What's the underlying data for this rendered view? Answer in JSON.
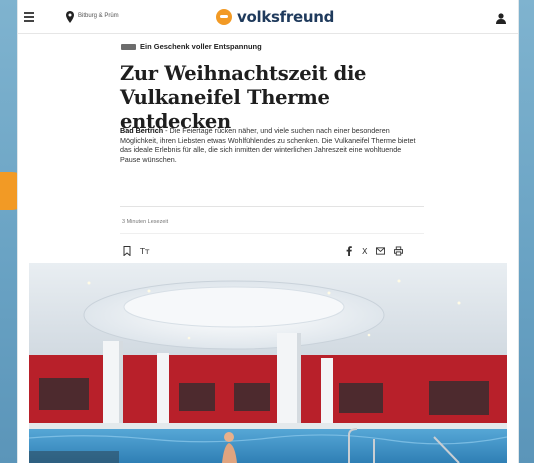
{
  "topbar": {
    "menu_label": "Ξ≡",
    "region_label": "Bitburg & Prüm",
    "logo_text": "volksfreund"
  },
  "article": {
    "kicker": "Ein Geschenk voller Entspannung",
    "headline": "Zur Weihnachtszeit die Vulkaneifel Therme entdecken",
    "teaser_location": "Bad Bertrich",
    "teaser_body": " - Die Feiertage rücken näher, und viele suchen nach einer besonderen Möglichkeit, ihren Liebsten etwas Wohlfühlendes zu schenken. Die Vulkaneifel Therme bietet das ideale Erlebnis für alle, die sich inmitten der winterlichen Jahreszeit eine wohltuende Pause wünschen.",
    "read_time": "3 Minuten Lesezeit"
  },
  "toolbar": {
    "text_size_label": "Tт",
    "share_x_label": "X"
  },
  "colors": {
    "accent_orange": "#f29a25",
    "logo_blue": "#1f3a5c",
    "photo_wall_red": "#b8202a",
    "photo_water": "#3f93c8"
  },
  "icons": [
    "menu-icon",
    "location-pin-icon",
    "user-icon",
    "bookmark-icon",
    "facebook-icon",
    "x-icon",
    "mail-icon",
    "print-icon"
  ]
}
